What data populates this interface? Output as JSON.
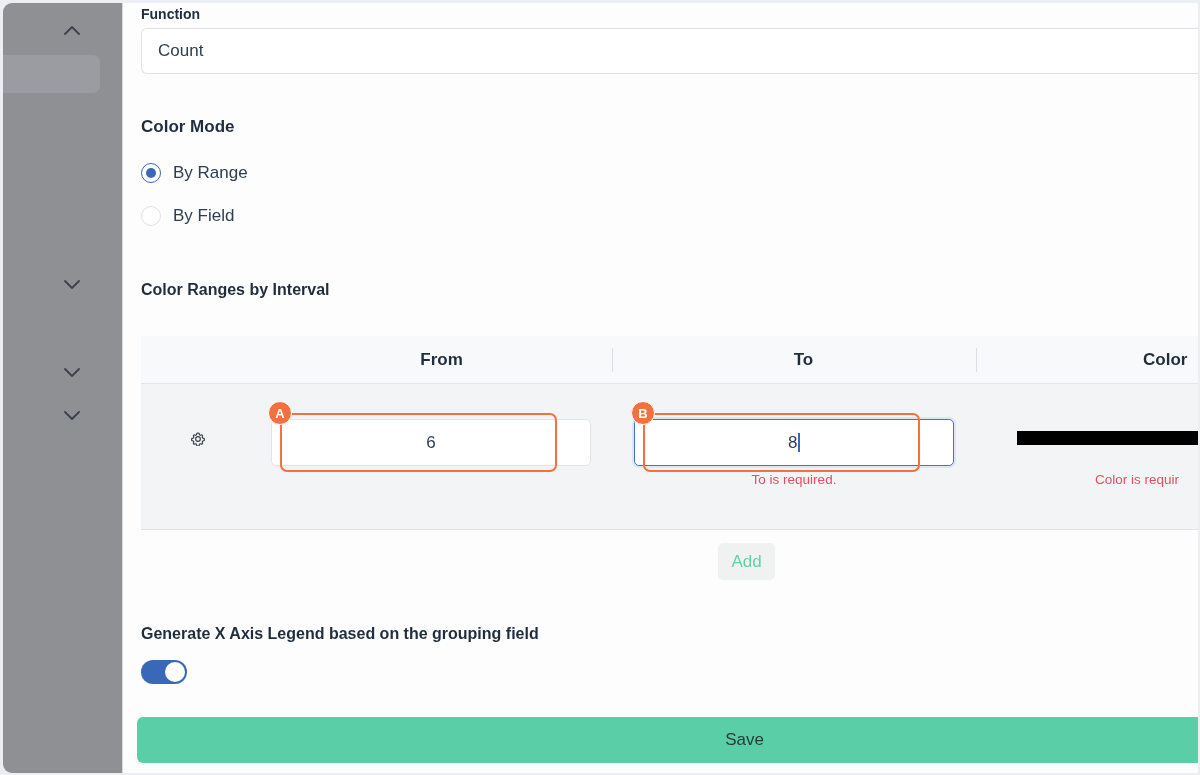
{
  "sidebar": {
    "items": [
      {
        "kind": "group",
        "expanded": true
      },
      {
        "kind": "link",
        "selected": true
      },
      {
        "kind": "group",
        "expanded": false
      },
      {
        "kind": "group",
        "expanded": false
      },
      {
        "kind": "group",
        "expanded": false
      }
    ]
  },
  "function": {
    "label": "Function",
    "value": "Count"
  },
  "color_mode": {
    "title": "Color Mode",
    "options": [
      {
        "label": "By Range",
        "selected": true
      },
      {
        "label": "By Field",
        "selected": false
      }
    ]
  },
  "color_ranges": {
    "title": "Color Ranges by Interval",
    "columns": [
      "From",
      "To",
      "Color"
    ],
    "rows": [
      {
        "from": {
          "value": "6",
          "focused": false,
          "callout": "A"
        },
        "to": {
          "value": "8",
          "focused": true,
          "error": "To is required.",
          "callout": "B"
        },
        "color": {
          "color": "#000000",
          "error": "Color is requir"
        }
      }
    ],
    "add_button": "Add"
  },
  "legend": {
    "label": "Generate X Axis Legend based on the grouping field",
    "on": true
  },
  "save_button": "Save"
}
